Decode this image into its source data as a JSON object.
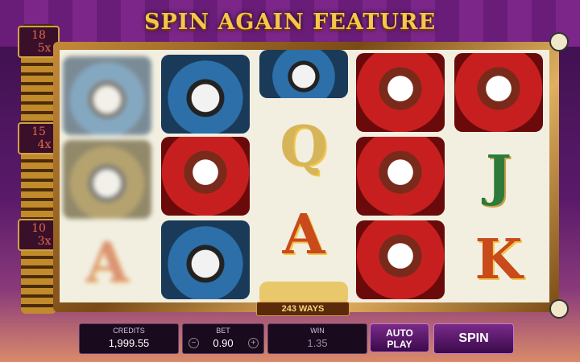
{
  "title": "SPIN AGAIN FEATURE",
  "multipliers": [
    {
      "top": "18",
      "bottom": "5x"
    },
    {
      "top": "15",
      "bottom": "4x"
    },
    {
      "top": "10",
      "bottom": "3x"
    }
  ],
  "ways_label": "243 WAYS",
  "reels": [
    [
      "masked-man-blurred",
      "man-green-hat-blurred",
      "letter-a-blurred"
    ],
    [
      "masked-man",
      "masked-woman",
      "masked-man"
    ],
    [
      "masked-man",
      "letter-q",
      "letter-a",
      "masked-woman-partial"
    ],
    [
      "masked-woman",
      "masked-woman",
      "masked-woman"
    ],
    [
      "masked-woman",
      "letter-j",
      "letter-k"
    ]
  ],
  "symbol_letters": {
    "q": "Q",
    "a": "A",
    "j": "J",
    "k": "K"
  },
  "credits": {
    "label": "CREDITS",
    "value": "1,999.55"
  },
  "bet": {
    "label": "BET",
    "value": "0.90",
    "minus": "−",
    "plus": "+"
  },
  "win": {
    "label": "WIN",
    "value": "1.35"
  },
  "buttons": {
    "autoplay_line1": "AUTO",
    "autoplay_line2": "PLAY",
    "spin": "SPIN"
  },
  "colors": {
    "gold": "#f6c64a",
    "panel": "#1a0a1e",
    "button": "#7a2a8a"
  }
}
